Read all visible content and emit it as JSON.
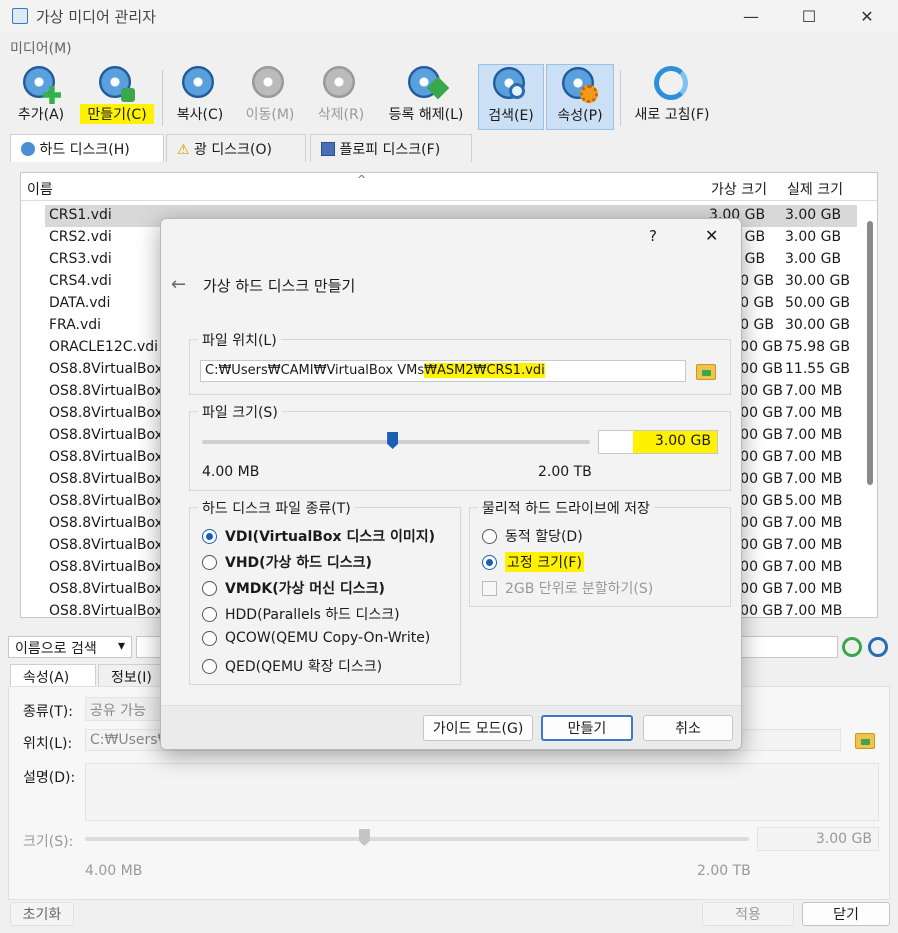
{
  "window": {
    "title": "가상 미디어 관리자",
    "controls": {
      "minimize": "—",
      "maximize": "☐",
      "close": "✕"
    }
  },
  "menu": {
    "media": "미디어(M)"
  },
  "toolbar": {
    "add": "추가(A)",
    "create": "만들기(C)",
    "copy": "복사(C)",
    "move": "이동(M)",
    "remove": "삭제(R)",
    "release": "등록 해제(L)",
    "search": "검색(E)",
    "properties": "속성(P)",
    "refresh": "새로 고침(F)"
  },
  "tabs": {
    "hard_disk": "하드 디스크(H)",
    "optical": "광 디스크(O)",
    "floppy": "플로피 디스크(F)"
  },
  "table": {
    "headers": {
      "name": "이름",
      "virtual_size": "가상 크기",
      "actual_size": "실제 크기"
    },
    "rows": [
      {
        "name": "CRS1.vdi",
        "vsize": "3.00 GB",
        "asize": "3.00 GB"
      },
      {
        "name": "CRS2.vdi",
        "vsize": "3.00 GB",
        "asize": "3.00 GB"
      },
      {
        "name": "CRS3.vdi",
        "vsize": "3.00 GB",
        "asize": "3.00 GB"
      },
      {
        "name": "CRS4.vdi",
        "vsize": "30.00 GB",
        "asize": "30.00 GB"
      },
      {
        "name": "DATA.vdi",
        "vsize": "50.00 GB",
        "asize": "50.00 GB"
      },
      {
        "name": "FRA.vdi",
        "vsize": "30.00 GB",
        "asize": "30.00 GB"
      },
      {
        "name": "ORACLE12C.vdi",
        "vsize": "100.00 GB",
        "asize": "75.98 GB"
      },
      {
        "name": "OS8.8VirtualBox",
        "vsize": "100.00 GB",
        "asize": "11.55 GB"
      },
      {
        "name": "OS8.8VirtualBox",
        "vsize": "100.00 GB",
        "asize": "7.00 MB"
      },
      {
        "name": "OS8.8VirtualBox",
        "vsize": "100.00 GB",
        "asize": "7.00 MB"
      },
      {
        "name": "OS8.8VirtualBox",
        "vsize": "100.00 GB",
        "asize": "7.00 MB"
      },
      {
        "name": "OS8.8VirtualBox",
        "vsize": "100.00 GB",
        "asize": "7.00 MB"
      },
      {
        "name": "OS8.8VirtualBox",
        "vsize": "100.00 GB",
        "asize": "7.00 MB"
      },
      {
        "name": "OS8.8VirtualBox",
        "vsize": "100.00 GB",
        "asize": "5.00 MB"
      },
      {
        "name": "OS8.8VirtualBox",
        "vsize": "100.00 GB",
        "asize": "7.00 MB"
      },
      {
        "name": "OS8.8VirtualBox",
        "vsize": "100.00 GB",
        "asize": "7.00 MB"
      },
      {
        "name": "OS8.8VirtualBox",
        "vsize": "100.00 GB",
        "asize": "7.00 MB"
      },
      {
        "name": "OS8.8VirtualBox",
        "vsize": "100.00 GB",
        "asize": "7.00 MB"
      },
      {
        "name": "OS8.8VirtualBox",
        "vsize": "100.00 GB",
        "asize": "7.00 MB"
      }
    ]
  },
  "search": {
    "mode": "이름으로 검색"
  },
  "bottom_tabs": {
    "attributes": "속성(A)",
    "info": "정보(I)"
  },
  "props": {
    "type_label": "종류(T):",
    "type_value": "공유 가능",
    "location_label": "위치(L):",
    "location_value": "C:₩Users₩",
    "desc_label": "설명(D):",
    "size_label": "크기(S):",
    "size_value": "3.00 GB",
    "size_fraction": 0.42,
    "min": "4.00 MB",
    "max": "2.00 TB"
  },
  "footer": {
    "reset": "초기화",
    "apply": "적용",
    "close": "닫기"
  },
  "dialog": {
    "help": "?",
    "close": "✕",
    "back": "←",
    "title": "가상 하드 디스크 만들기",
    "file_location": {
      "label": "파일 위치(L)",
      "path_plain": "C:₩Users₩CAMI₩VirtualBox VMs",
      "path_highlight": "₩ASM2₩CRS1.vdi"
    },
    "file_size": {
      "label": "파일 크기(S)",
      "value": "3.00 GB",
      "min": "4.00 MB",
      "max": "2.00 TB",
      "fraction": 0.49
    },
    "disk_type": {
      "label": "하드 디스크 파일 종류(T)",
      "options": [
        {
          "text": "VDI(VirtualBox 디스크 이미지)",
          "selected": true
        },
        {
          "text": "VHD(가상 하드 디스크)",
          "selected": false
        },
        {
          "text": "VMDK(가상 머신 디스크)",
          "selected": false
        },
        {
          "text": "HDD(Parallels 하드 디스크)",
          "selected": false
        },
        {
          "text": "QCOW(QEMU Copy-On-Write)",
          "selected": false
        },
        {
          "text": "QED(QEMU 확장 디스크)",
          "selected": false
        }
      ]
    },
    "storage": {
      "label": "물리적 하드 드라이브에 저장",
      "dynamic": "동적 할당(D)",
      "fixed": "고정 크기(F)",
      "split": "2GB 단위로 분할하기(S)"
    },
    "buttons": {
      "guided": "가이드 모드(G)",
      "create": "만들기",
      "cancel": "취소"
    }
  }
}
